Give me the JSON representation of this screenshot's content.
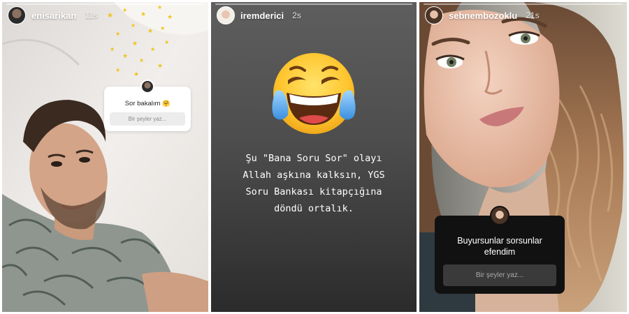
{
  "stories": [
    {
      "username": "enisarikan",
      "time": "11s",
      "question_sticker": {
        "title": "Sor bakalım",
        "emoji": "🤗",
        "placeholder": "Bir şeyler yaz..."
      }
    },
    {
      "username": "iremderici",
      "time": "2s",
      "emoji_name": "face-with-tears-of-joy",
      "text": "Şu \"Bana Soru Sor\" olayı\nAllah aşkına kalksın, YGS\nSoru Bankası kitapçığına\ndöndü ortalık."
    },
    {
      "username": "sebnembozoklu",
      "time": "21s",
      "question_sticker": {
        "title": "Buyursunlar sorsunlar efendim",
        "placeholder": "Bir şeyler yaz..."
      }
    }
  ],
  "colors": {
    "sticker_dark": "#111111",
    "sticker_light": "#ffffff",
    "input_light": "#ececec",
    "input_dark": "#3a3a3a"
  }
}
